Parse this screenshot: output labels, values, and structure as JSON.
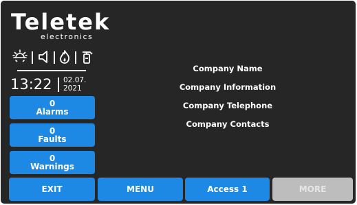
{
  "brand": {
    "name": "Teletek",
    "tagline": "electronics"
  },
  "status_icons": [
    "brightness-icon",
    "sounder-icon",
    "fire-icon",
    "extinguisher-icon"
  ],
  "clock": {
    "time": "13:22",
    "date_day_month": "02.07.",
    "date_year": "2021"
  },
  "counters": {
    "alarms": {
      "count": "0",
      "label": "Alarms"
    },
    "faults": {
      "count": "0",
      "label": "Faults"
    },
    "warnings": {
      "count": "0",
      "label": "Warnings"
    }
  },
  "company": {
    "name": "Company Name",
    "information": "Company Information",
    "telephone": "Company Telephone",
    "contacts": "Company Contacts"
  },
  "bottom_bar": {
    "exit_label": "EXIT",
    "menu_label": "MENU",
    "access_label": "Access 1",
    "more_label": "MORE"
  },
  "colors": {
    "background": "#262626",
    "button_blue": "#1e88e5",
    "button_disabled": "#bdbdbd",
    "text": "#ffffff"
  }
}
